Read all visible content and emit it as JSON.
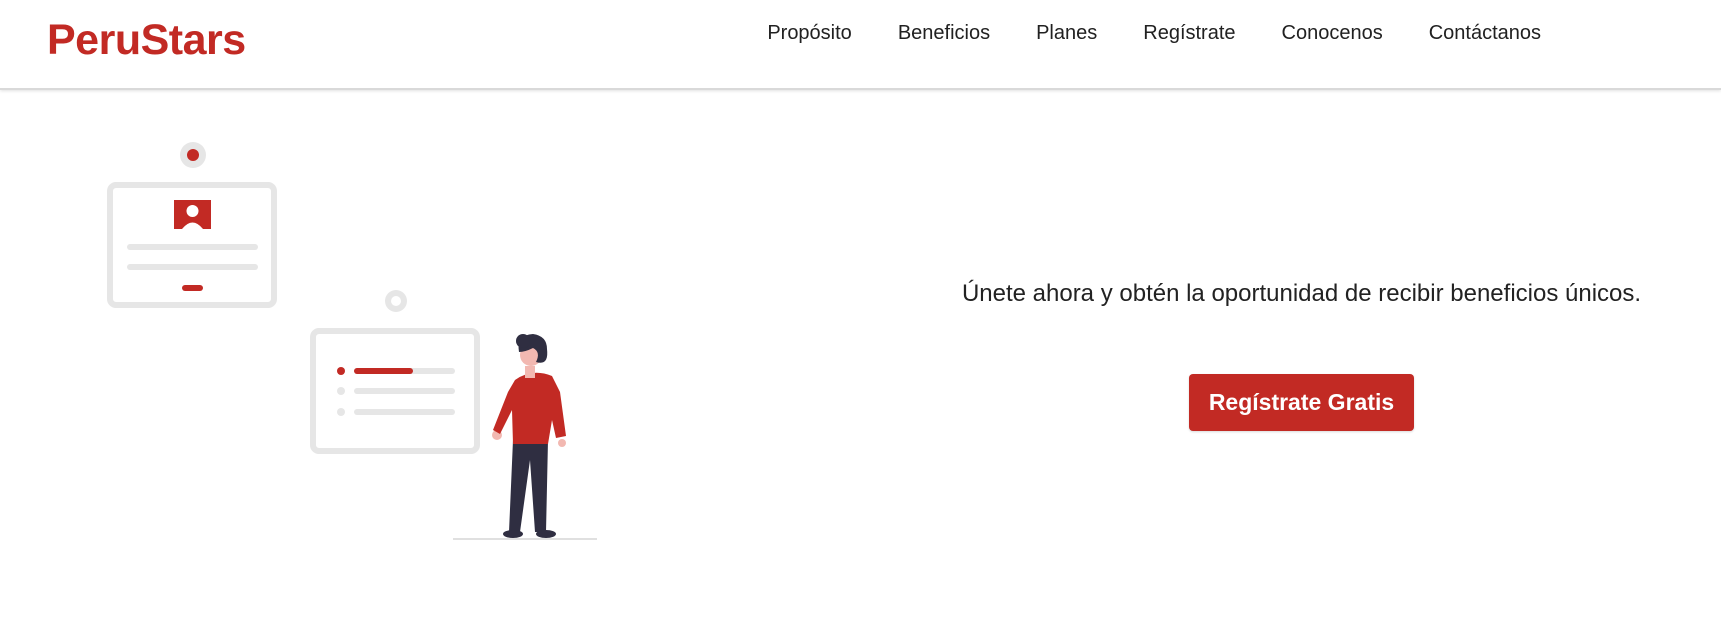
{
  "brand": {
    "name": "PeruStars",
    "color": "#c22a24"
  },
  "nav": {
    "items": [
      {
        "label": "Propósito"
      },
      {
        "label": "Beneficios"
      },
      {
        "label": "Planes"
      },
      {
        "label": "Regístrate"
      },
      {
        "label": "Conocenos"
      },
      {
        "label": "Contáctanos"
      }
    ]
  },
  "hero": {
    "tagline": "Únete ahora y obtén la oportunidad de recibir beneficios únicos.",
    "cta_label": "Regístrate Gratis",
    "illustration": "person-viewing-id-cards-illustration"
  },
  "colors": {
    "accent": "#c22a24",
    "text": "#222222",
    "card_outline": "#e6e6e6",
    "figure_dark": "#2f2e41"
  }
}
